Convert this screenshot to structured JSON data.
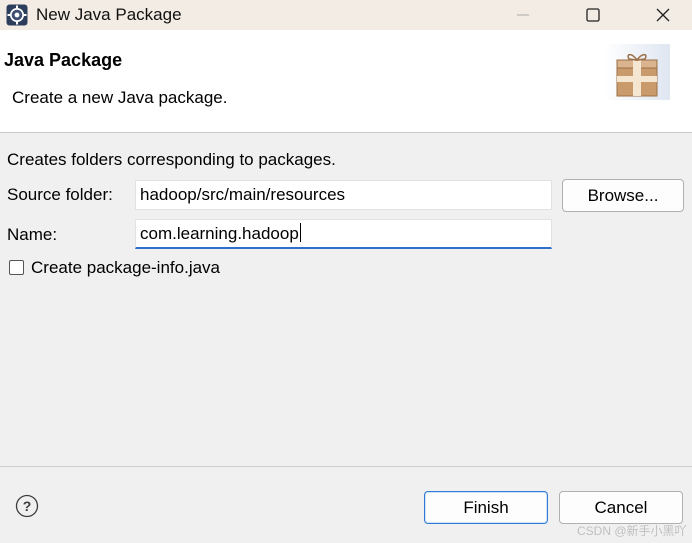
{
  "window": {
    "title": "New Java Package",
    "app_icon": "eclipse-icon",
    "controls": [
      "minimize-icon",
      "maximize-icon",
      "close-icon"
    ]
  },
  "header": {
    "title": "Java Package",
    "description": "Create a new Java package.",
    "banner_icon": "package-icon"
  },
  "form": {
    "info": "Creates folders corresponding to packages.",
    "source_folder_label": "Source folder:",
    "source_folder_value": "hadoop/src/main/resources",
    "browse_label": "Browse...",
    "name_label": "Name:",
    "name_value": "com.learning.hadoop",
    "checkbox_label": "Create package-info.java",
    "checkbox_checked": false
  },
  "footer": {
    "help_icon": "help-icon",
    "finish_label": "Finish",
    "cancel_label": "Cancel"
  },
  "watermark": "CSDN @新手小黑吖",
  "colors": {
    "titlebar": "#f3ece4",
    "focus_underline": "#2f6fc8",
    "default_button_border": "#2f7bd6"
  }
}
